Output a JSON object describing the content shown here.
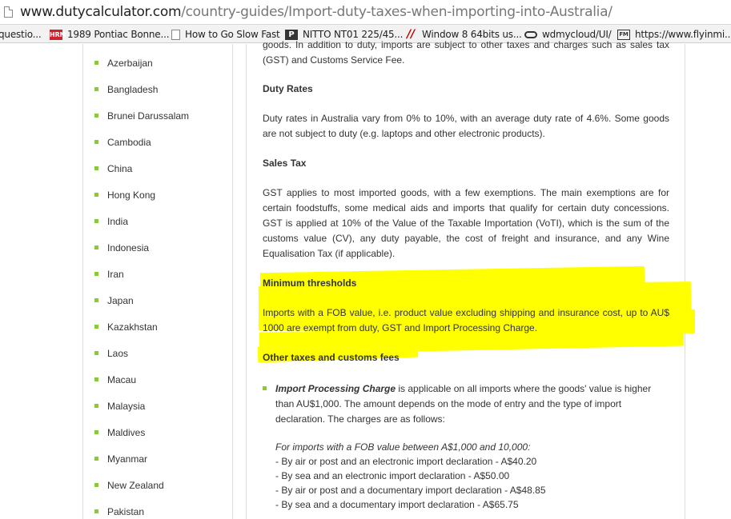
{
  "browser": {
    "url_host": "www.dutycalculator.com",
    "url_path": "/country-guides/Import-duty-taxes-when-importing-into-Australia/"
  },
  "bookmarks": [
    {
      "icon": "",
      "label": "questio..."
    },
    {
      "icon": "HRM",
      "label": "1989 Pontiac Bonne..."
    },
    {
      "icon": "",
      "label": "How to Go Slow Fast"
    },
    {
      "icon": "P",
      "label": "NITTO NT01 225/45..."
    },
    {
      "icon": "//",
      "label": "Window 8 64bits us..."
    },
    {
      "icon": "",
      "label": "wdmycloud/UI/"
    },
    {
      "icon": "FM",
      "label": "https://www.flyinmi..."
    }
  ],
  "sidebar": {
    "countries": [
      "Azerbaijan",
      "Bangladesh",
      "Brunei Darussalam",
      "Cambodia",
      "China",
      "Hong Kong",
      "India",
      "Indonesia",
      "Iran",
      "Japan",
      "Kazakhstan",
      "Laos",
      "Macau",
      "Malaysia",
      "Maldives",
      "Myanmar",
      "New Zealand",
      "Pakistan"
    ]
  },
  "content": {
    "intro_tail": "goods.  In addition to duty, imports are subject to other taxes and charges such as sales tax (GST) and Customs Service Fee.",
    "duty_rates_heading": "Duty Rates",
    "duty_rates_text": "Duty rates in Australia vary from 0% to 10%, with an average duty rate of 4.6%.  Some goods are not subject to duty (e.g. laptops and other electronic products).",
    "sales_tax_heading": "Sales Tax",
    "sales_tax_text": "GST applies to most imported goods, with a few exemptions. The main exemptions are for certain foodstuffs, some medical aids and imports that qualify for certain duty concessions. GST is applied at 10% of the Value of the Taxable Importation (VoTI), which is the sum of the customs value (CV), any duty payable, the cost of freight and insurance, and any Wine Equalisation Tax (if applicable).",
    "min_thresholds_heading": "Minimum thresholds",
    "min_thresholds_text": "Imports with a FOB value, i.e. product value excluding shipping and insurance cost, up to AU$ 1000 are exempt from duty, GST and Import Processing Charge.",
    "other_taxes_heading": "Other taxes and customs fees",
    "ipc_title": "Import Processing Charge",
    "ipc_text": " is applicable on all imports where the goods' value is higher than AU$1,000.  The amount depends on the mode of entry and the type of import declaration.  The charges are as follows:",
    "ipc_range_label": "For imports with a FOB value between A$1,000 and 10,000:",
    "ipc_lines": [
      "- By air or post and an electronic import declaration - A$40.20",
      "- By sea and an electronic import declaration - A$50.00",
      "- By air or post and a documentary import declaration - A$48.85",
      "- By sea and a documentary import declaration - A$65.75"
    ]
  },
  "colors": {
    "bullet": "#8dc63f",
    "highlight": "#ffff00"
  }
}
